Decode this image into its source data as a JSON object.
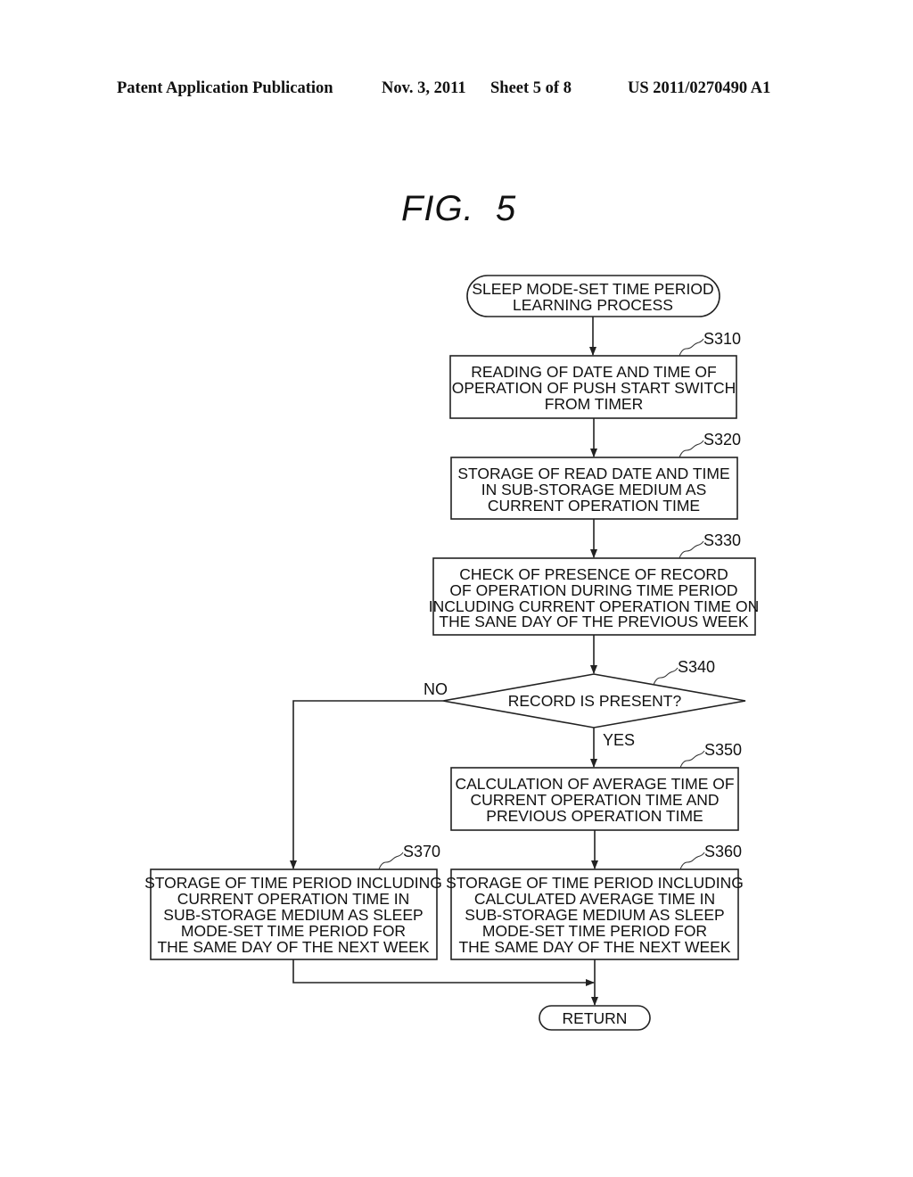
{
  "header": {
    "publication": "Patent Application Publication",
    "date": "Nov. 3, 2011",
    "sheet": "Sheet 5 of 8",
    "number": "US 2011/0270490 A1"
  },
  "figure": {
    "title": "FIG.  5"
  },
  "flowchart": {
    "start": {
      "lines": [
        "SLEEP MODE-SET TIME PERIOD",
        "LEARNING PROCESS"
      ]
    },
    "steps": [
      {
        "id": "S310",
        "lines": [
          "READING OF DATE AND TIME OF",
          "OPERATION OF PUSH START SWITCH",
          "FROM TIMER"
        ]
      },
      {
        "id": "S320",
        "lines": [
          "STORAGE OF READ DATE AND TIME",
          "IN SUB-STORAGE MEDIUM AS",
          "CURRENT OPERATION TIME"
        ]
      },
      {
        "id": "S330",
        "lines": [
          "CHECK OF PRESENCE OF RECORD",
          "OF OPERATION DURING TIME PERIOD",
          "INCLUDING CURRENT OPERATION TIME ON",
          "THE SANE DAY OF THE PREVIOUS WEEK"
        ]
      },
      {
        "id": "S340",
        "lines": [
          "RECORD IS PRESENT?"
        ],
        "type": "decision",
        "yes": "YES",
        "no": "NO"
      },
      {
        "id": "S350",
        "lines": [
          "CALCULATION OF AVERAGE TIME OF",
          "CURRENT OPERATION TIME AND",
          "PREVIOUS OPERATION TIME"
        ]
      },
      {
        "id": "S360",
        "lines": [
          "STORAGE OF TIME PERIOD INCLUDING",
          "CALCULATED AVERAGE TIME IN",
          "SUB-STORAGE MEDIUM AS SLEEP",
          "MODE-SET TIME PERIOD FOR",
          "THE SAME DAY OF THE NEXT WEEK"
        ]
      },
      {
        "id": "S370",
        "lines": [
          "STORAGE OF TIME PERIOD INCLUDING",
          "CURRENT OPERATION TIME IN",
          "SUB-STORAGE MEDIUM AS SLEEP",
          "MODE-SET TIME PERIOD FOR",
          "THE SAME DAY OF THE NEXT WEEK"
        ]
      }
    ],
    "end": {
      "lines": [
        "RETURN"
      ]
    }
  }
}
